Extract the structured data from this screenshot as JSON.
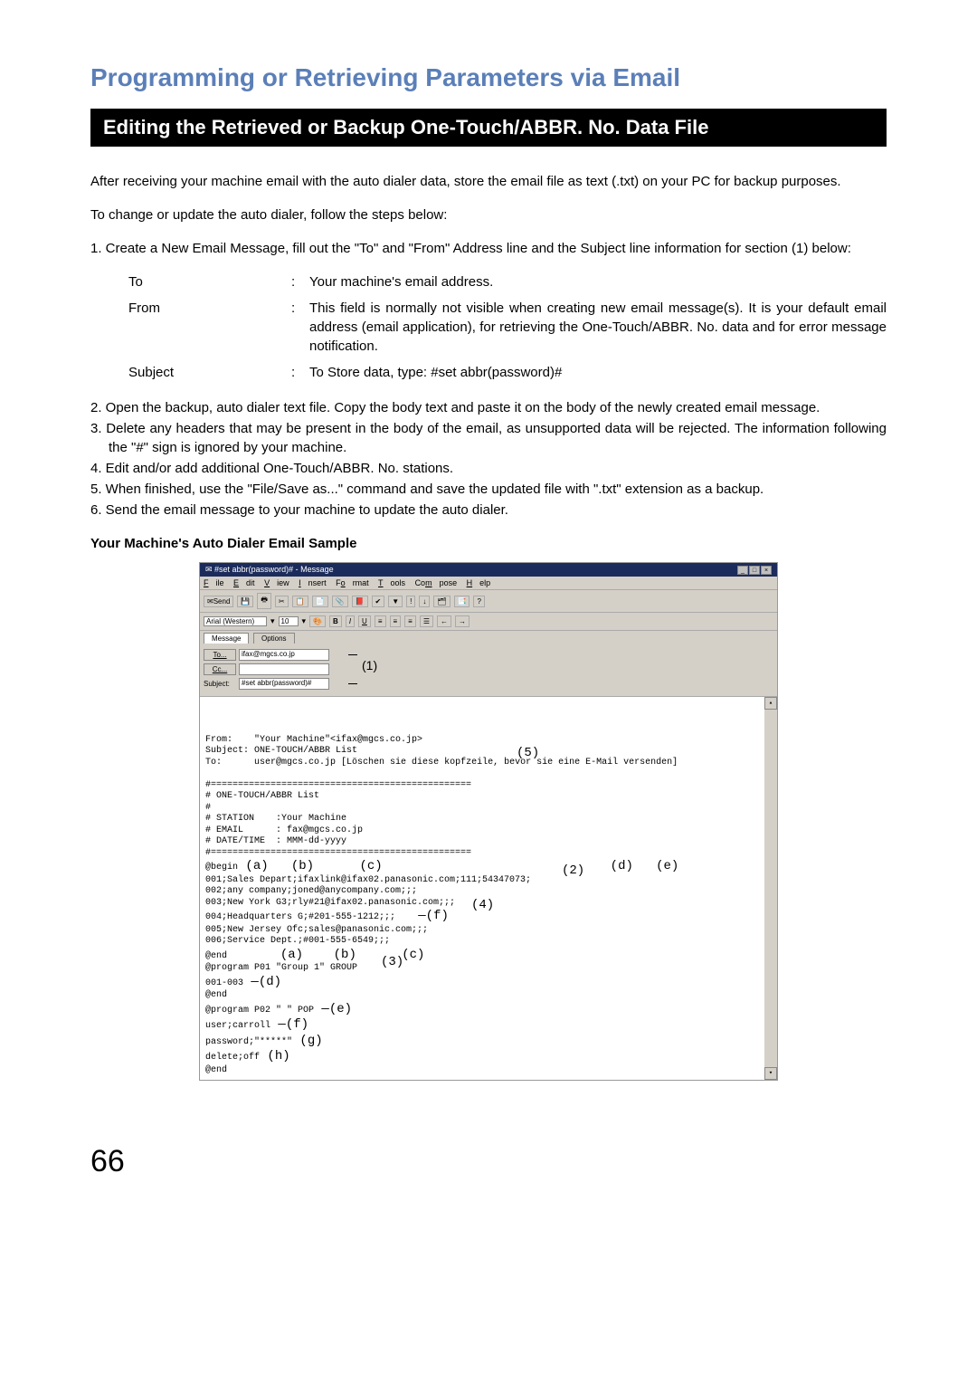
{
  "page_title": "Programming or Retrieving Parameters via Email",
  "section_header": "Editing the Retrieved or Backup One-Touch/ABBR. No. Data File",
  "intro_para": "After receiving your machine email with the auto dialer data, store the email file as text (.txt) on your PC for backup purposes.",
  "change_para": "To change or update the auto dialer, follow the steps below:",
  "step1": "1. Create a New Email Message, fill out the \"To\" and \"From\" Address line and the Subject line information for section (1) below:",
  "fields": {
    "to_label": "To",
    "to_value": "Your machine's email address.",
    "from_label": "From",
    "from_value": "This field is normally not visible when creating new email message(s). It is your default email address (email application), for retrieving the One-Touch/ABBR. No. data and for error message notification.",
    "subject_label": "Subject",
    "subject_value": "To Store data, type: #set abbr(password)#"
  },
  "step2": "2. Open the backup, auto dialer text file.  Copy the body text and paste it on the body of the newly created email message.",
  "step3": "3. Delete any headers that may be present in the body of the email, as unsupported data will be rejected. The information following the \"#\" sign is ignored by your machine.",
  "step4": "4. Edit and/or add additional One-Touch/ABBR. No. stations.",
  "step5": "5. When finished, use the \"File/Save as...\" command and save the updated file with \".txt\" extension as a backup.",
  "step6": "6. Send the email message to your machine to update the auto dialer.",
  "sample_heading": "Your Machine's Auto Dialer Email Sample",
  "email": {
    "titlebar": "#set abbr(password)# - Message",
    "menu": {
      "file": "File",
      "edit": "Edit",
      "view": "View",
      "insert": "Insert",
      "format": "Format",
      "tools": "Tools",
      "compose": "Compose",
      "help": "Help"
    },
    "send_btn": "Send",
    "font_name": "Arial (Western)",
    "font_size": "10",
    "bold": "B",
    "italic": "I",
    "underline": "U",
    "tab_message": "Message",
    "tab_options": "Options",
    "to_btn": "To...",
    "to_field": "ifax@mgcs.co.jp",
    "cc_btn": "Cc...",
    "cc_field": "",
    "subject_lbl": "Subject:",
    "subject_field": "#set abbr(password)#",
    "body_from": "From:    \"Your Machine\"<ifax@mgcs.co.jp>",
    "body_subject": "Subject: ONE-TOUCH/ABBR List",
    "body_to": "To:      user@mgcs.co.jp",
    "german": "[Löschen sie diese kopfzeile, bevor sie eine E-Mail versenden]",
    "sep": "#================================================",
    "list_title": "# ONE-TOUCH/ABBR List",
    "hash": "#",
    "station_line": "# STATION    :Your Machine",
    "email_line": "# EMAIL      : fax@mgcs.co.jp",
    "date_line": "# DATE/TIME  : MMM-dd-yyyy",
    "sep2": "#================================================",
    "begin": "@begin",
    "l001": "001;Sales Depart;ifaxlink@ifax02.panasonic.com;111;54347073;",
    "l002": "002;any company;joned@anycompany.com;;;",
    "l003": "003;New York G3;rly#21@ifax02.panasonic.com;;;",
    "l004": "004;Headquarters G;#201-555-1212;;;",
    "l005": "005;New Jersey Ofc;sales@panasonic.com;;;",
    "l006": "006;Service Dept.;#001-555-6549;;;",
    "end1": "@end",
    "prog1": "@program P01 \"Group 1\" GROUP",
    "range": "001-003",
    "end2": "@end",
    "prog2": "@program P02 \" \" POP",
    "user": "user;carroll",
    "pass": "password;\"*****\"",
    "del": "delete;off",
    "end3": "@end",
    "callouts": {
      "c1": "(1)",
      "c2": "(2)",
      "c3": "(3)",
      "c4": "(4)",
      "c5": "(5)",
      "a": "(a)",
      "b": "(b)",
      "c": "(c)",
      "d": "(d)",
      "e": "(e)",
      "f": "(f)",
      "g": "(g)",
      "h": "(h)"
    }
  },
  "page_number": "66"
}
